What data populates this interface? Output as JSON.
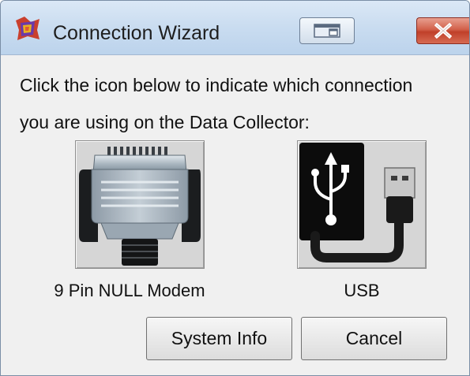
{
  "window": {
    "title": "Connection Wizard"
  },
  "instruction": {
    "line1": "Click the icon below to indicate which connection",
    "line2": "you are using on the Data Collector:"
  },
  "connections": [
    {
      "label": "9 Pin NULL Modem",
      "icon": "serial-connector-icon"
    },
    {
      "label": "USB",
      "icon": "usb-cable-icon"
    }
  ],
  "buttons": {
    "system_info": "System Info",
    "cancel": "Cancel"
  }
}
